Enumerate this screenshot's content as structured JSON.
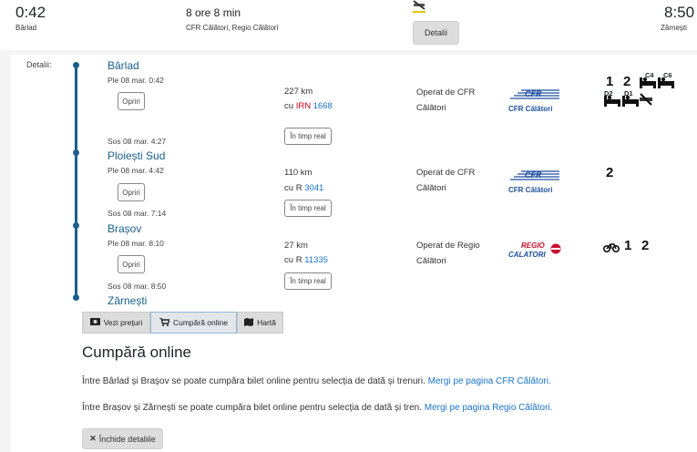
{
  "summary": {
    "depart_time": "0:42",
    "depart_station": "Bârlad",
    "duration": "8 ore 8 min",
    "operators": "CFR Călători, Regio Călători",
    "details_button": "Detalii",
    "arrive_time": "8:50",
    "arrive_station": "Zărnești"
  },
  "details_label": "Detalii:",
  "legs": [
    {
      "from_station": "Bârlad",
      "departure": "Ple 08 mar. 0:42",
      "stops_button": "Opriri",
      "distance": "227 km",
      "train_prefix": "cu",
      "train_type": "IRN",
      "train_number": "1668",
      "realtime_button": "În timp real",
      "operator": "Operat de CFR Călători",
      "operator_logo": "CFR Călători",
      "arrival": "Sos 08 mar. 4:27"
    },
    {
      "from_station": "Ploiești Sud",
      "departure": "Ple 08 mar. 4:42",
      "stops_button": "Opriri",
      "distance": "110 km",
      "train_prefix": "cu",
      "train_type": "R",
      "train_number": "3041",
      "realtime_button": "În timp real",
      "operator": "Operat de CFR Călători",
      "operator_logo": "CFR Călători",
      "arrival": "Sos 08 mar. 7:14"
    },
    {
      "from_station": "Brașov",
      "departure": "Ple 08 mar. 8:10",
      "stops_button": "Opriri",
      "distance": "27 km",
      "train_prefix": "cu",
      "train_type": "R",
      "train_number": "11335",
      "realtime_button": "În timp real",
      "operator": "Operat de Regio Călători",
      "operator_logo_top": "REGIO",
      "operator_logo_bottom": "CALATORI",
      "arrival": "Sos 08 mar. 8:50"
    }
  ],
  "final_station": "Zărnești",
  "facilities": {
    "leg1_class1": "1",
    "leg1_class2": "2",
    "leg1_c4": "C4",
    "leg1_c6": "C6",
    "leg1_d2": "D2",
    "leg1_d1": "D1",
    "leg2_class2": "2",
    "leg3_class1": "1",
    "leg3_class2": "2"
  },
  "tabs": {
    "prices": "Vezi prețuri",
    "buy": "Cumpără online",
    "map": "Hartă"
  },
  "buy_section": {
    "title": "Cumpără online",
    "line1_text": "Între Bârlad și Brașov se poate cumpăra bilet online pentru selecția de dată și trenuri.",
    "line1_link": "Mergi pe pagina CFR Călători.",
    "line2_text": "Între Brașov și Zărnești se poate cumpăra bilet online pentru selecția de dată și tren.",
    "line2_link": "Mergi pe pagina Regio Călători.",
    "close_button": "Închide detaliile"
  },
  "colors": {
    "accent": "#1a5f8c",
    "link": "#1a73c8",
    "red": "#d0021b"
  }
}
